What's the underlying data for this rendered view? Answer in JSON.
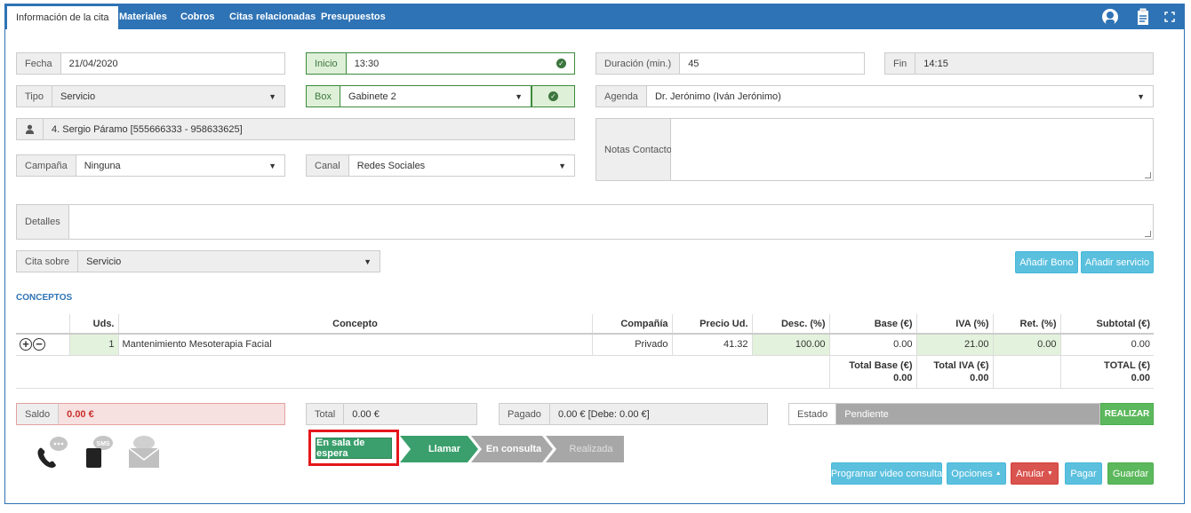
{
  "tabs": [
    "Información de la cita",
    "Materiales",
    "Cobros",
    "Citas relacionadas",
    "Presupuestos"
  ],
  "header_icons": [
    "user-avatar-icon",
    "clipboard-icon",
    "fullscreen-icon"
  ],
  "fields": {
    "fecha": {
      "label": "Fecha",
      "value": "21/04/2020"
    },
    "inicio": {
      "label": "Inicio",
      "value": "13:30"
    },
    "duracion": {
      "label": "Duración (min.)",
      "value": "45"
    },
    "fin": {
      "label": "Fin",
      "value": "14:15"
    },
    "tipo": {
      "label": "Tipo",
      "value": "Servicio"
    },
    "box": {
      "label": "Box",
      "value": "Gabinete 2"
    },
    "agenda": {
      "label": "Agenda",
      "value": "Dr. Jerónimo (Iván Jerónimo)"
    },
    "paciente": {
      "value": "4. Sergio Páramo [555666333 - 958633625]"
    },
    "notas": {
      "label": "Notas Contacto",
      "value": ""
    },
    "campana": {
      "label": "Campaña",
      "value": "Ninguna"
    },
    "canal": {
      "label": "Canal",
      "value": "Redes Sociales"
    },
    "detalles": {
      "label": "Detalles",
      "value": ""
    },
    "cita_sobre": {
      "label": "Cita sobre",
      "value": "Servicio"
    }
  },
  "buttons": {
    "anadir_bono": "Añadir Bono",
    "anadir_servicio": "Añadir servicio",
    "realizar": "REALIZAR",
    "programar": "Programar video consulta",
    "opciones": "Opciones",
    "anular": "Anular",
    "pagar": "Pagar",
    "guardar": "Guardar"
  },
  "conceptos": {
    "title": "CONCEPTOS",
    "headers": [
      "",
      "Uds.",
      "Concepto",
      "Compañía",
      "Precio Ud.",
      "Desc. (%)",
      "Base (€)",
      "IVA (%)",
      "Ret. (%)",
      "Subtotal (€)"
    ],
    "rows": [
      {
        "uds": "1",
        "concepto": "Mantenimiento Mesoterapia Facial",
        "compania": "Privado",
        "precio": "41.32",
        "desc": "100.00",
        "base": "0.00",
        "iva": "21.00",
        "ret": "0.00",
        "subtotal": "0.00"
      }
    ],
    "totals": {
      "base_label": "Total Base (€)",
      "base": "0.00",
      "iva_label": "Total IVA (€)",
      "iva": "0.00",
      "total_label": "TOTAL (€)",
      "total": "0.00"
    }
  },
  "summary": {
    "saldo": {
      "label": "Saldo",
      "value": "0.00 €"
    },
    "total": {
      "label": "Total",
      "value": "0.00 €"
    },
    "pagado": {
      "label": "Pagado",
      "value": "0.00 € [Debe: 0.00 €]"
    },
    "estado": {
      "label": "Estado",
      "value": "Pendiente"
    }
  },
  "contact_icons": [
    "phone-icon",
    "sms-icon",
    "email-icon"
  ],
  "stages": [
    "En sala de espera",
    "Llamar",
    "En consulta",
    "Realizada"
  ],
  "colors": {
    "primary": "#2e73b5",
    "success": "#5cb85c",
    "info": "#5bc0de",
    "danger": "#d9534f",
    "stage_active": "#3a9f6c",
    "stage_pending": "#a7a7a7",
    "highlight": "#e4171c"
  }
}
